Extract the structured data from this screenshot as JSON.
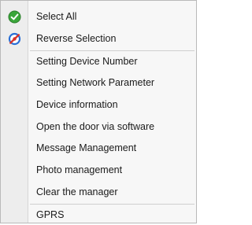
{
  "menu": {
    "items": [
      {
        "label": "Select All",
        "icon": "check-circle-icon"
      },
      {
        "label": "Reverse Selection",
        "icon": "reverse-selection-icon"
      },
      {
        "label": "Setting Device Number"
      },
      {
        "label": "Setting Network Parameter"
      },
      {
        "label": "Device information"
      },
      {
        "label": "Open the door via software"
      },
      {
        "label": "Message Management"
      },
      {
        "label": "Photo management"
      },
      {
        "label": "Clear the manager"
      },
      {
        "label": "GPRS"
      }
    ]
  },
  "colors": {
    "check_green": "#3aa63a",
    "reverse_red": "#d9342b",
    "reverse_blue": "#2a6fd6"
  }
}
